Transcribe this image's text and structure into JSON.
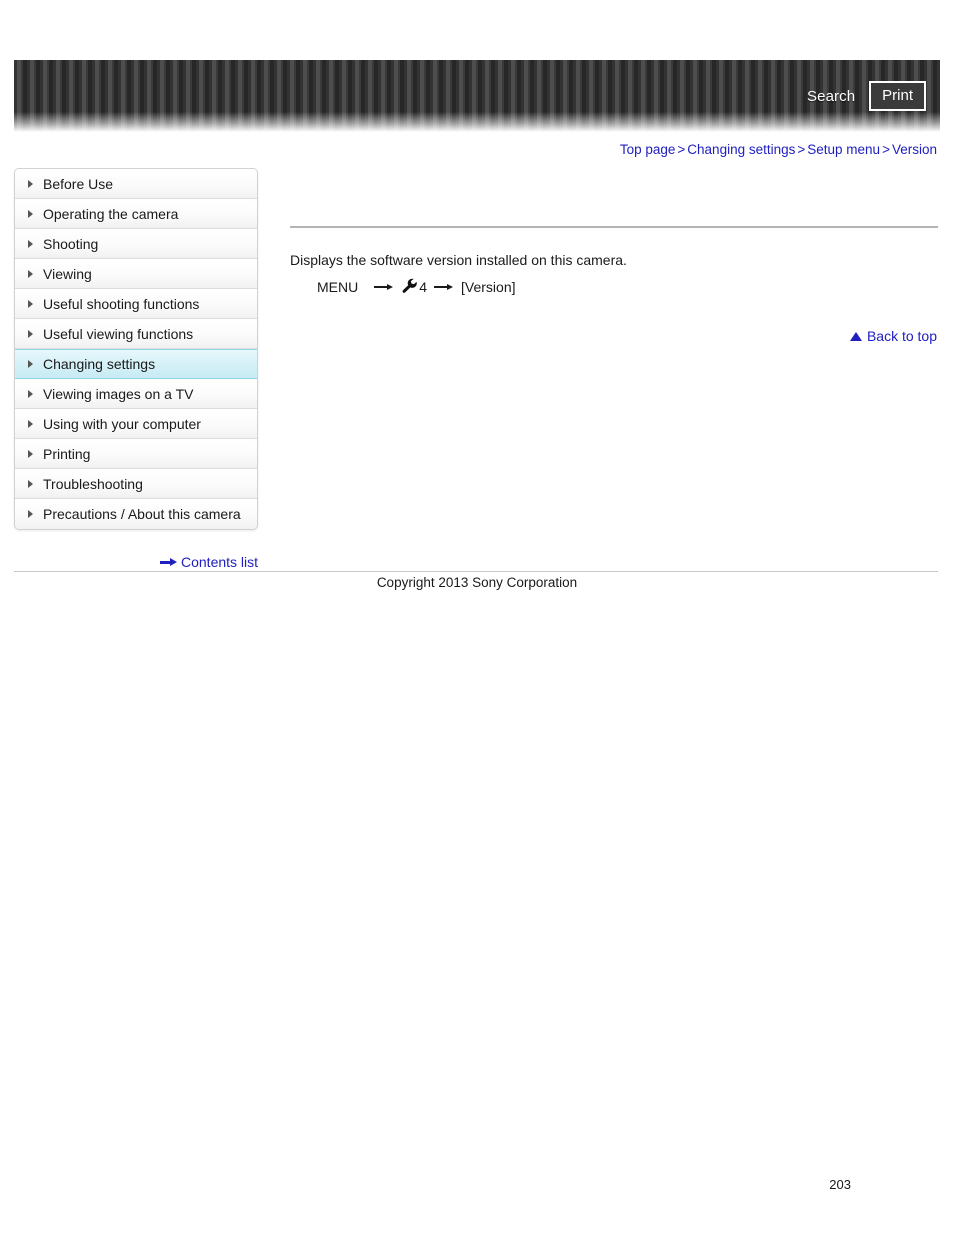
{
  "header": {
    "search_label": "Search",
    "print_label": "Print"
  },
  "breadcrumb": {
    "separator": ">",
    "items": [
      {
        "label": "Top page"
      },
      {
        "label": "Changing settings"
      },
      {
        "label": "Setup menu"
      },
      {
        "label": "Version"
      }
    ]
  },
  "sidebar": {
    "items": [
      {
        "label": "Before Use",
        "active": false
      },
      {
        "label": "Operating the camera",
        "active": false
      },
      {
        "label": "Shooting",
        "active": false
      },
      {
        "label": "Viewing",
        "active": false
      },
      {
        "label": "Useful shooting functions",
        "active": false
      },
      {
        "label": "Useful viewing functions",
        "active": false
      },
      {
        "label": "Changing settings",
        "active": true
      },
      {
        "label": "Viewing images on a TV",
        "active": false
      },
      {
        "label": "Using with your computer",
        "active": false
      },
      {
        "label": "Printing",
        "active": false
      },
      {
        "label": "Troubleshooting",
        "active": false
      },
      {
        "label": "Precautions / About this camera",
        "active": false
      }
    ],
    "contents_list_label": "Contents list"
  },
  "main": {
    "description": "Displays the software version installed on this camera.",
    "menu_path": {
      "menu_label": "MENU",
      "setup_icon": "wrench-icon",
      "setup_number": "4",
      "item_label": "[Version]"
    },
    "back_to_top_label": "Back to top"
  },
  "footer": {
    "copyright": "Copyright 2013 Sony Corporation",
    "page_number": "203"
  },
  "colors": {
    "link": "#2020c0",
    "active_highlight": "#d4f0f7",
    "header_dark": "#333333"
  }
}
